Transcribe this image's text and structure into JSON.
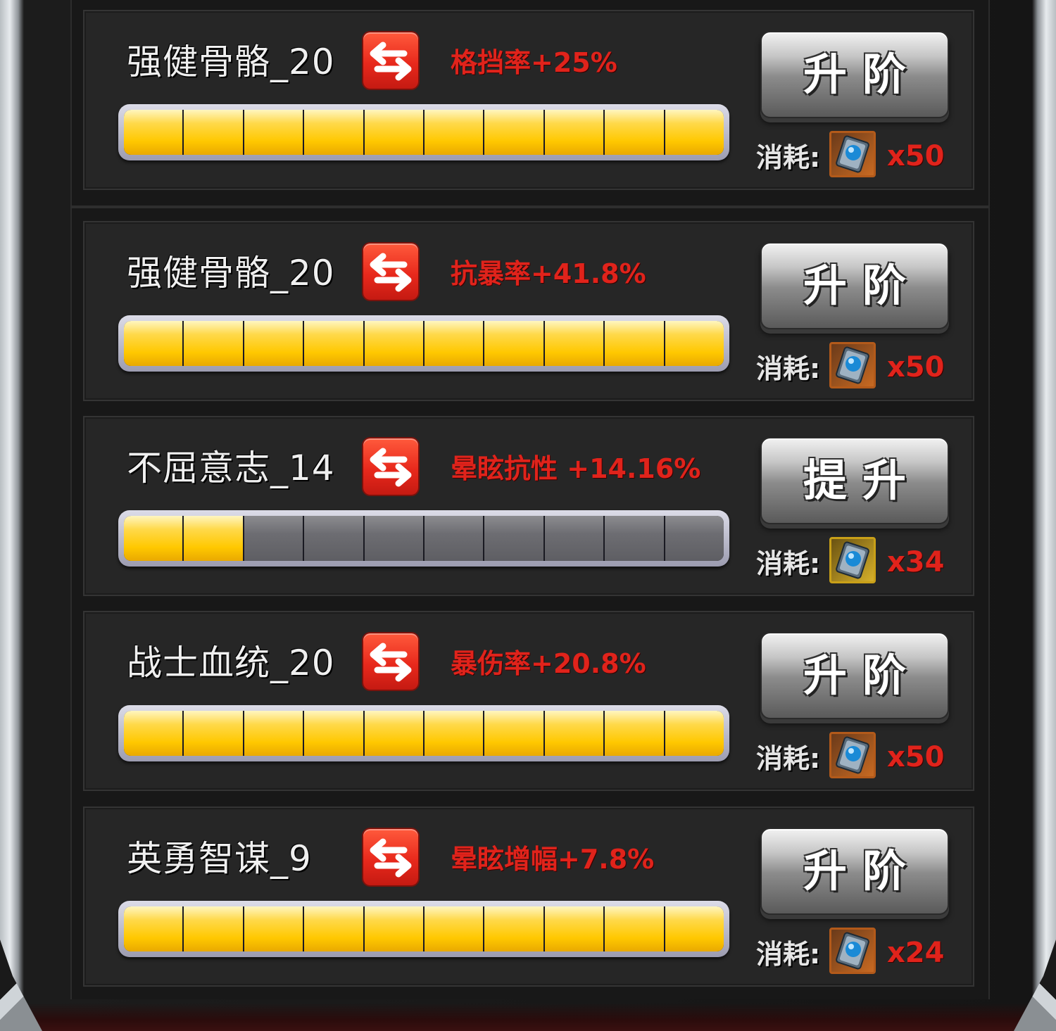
{
  "cost_prefix": "消耗:",
  "skills": [
    {
      "name": "强健骨骼_20",
      "stat": "格挡率+25%",
      "button": "升阶",
      "cost": "x50",
      "filled_segments": 10,
      "total_segments": 10,
      "item_style": "orange",
      "icon": "swap-arrows-icon"
    },
    {
      "name": "强健骨骼_20",
      "stat": "抗暴率+41.8%",
      "button": "升阶",
      "cost": "x50",
      "filled_segments": 10,
      "total_segments": 10,
      "item_style": "orange",
      "icon": "swap-arrows-icon"
    },
    {
      "name": "不屈意志_14",
      "stat": "晕眩抗性 +14.16%",
      "button": "提升",
      "cost": "x34",
      "filled_segments": 2,
      "total_segments": 10,
      "item_style": "gold",
      "icon": "swap-arrows-icon"
    },
    {
      "name": "战士血统_20",
      "stat": "暴伤率+20.8%",
      "button": "升阶",
      "cost": "x50",
      "filled_segments": 10,
      "total_segments": 10,
      "item_style": "orange",
      "icon": "swap-arrows-icon"
    },
    {
      "name": "英勇智谋_9",
      "stat": "晕眩增幅+7.8%",
      "button": "升阶",
      "cost": "x24",
      "filled_segments": 10,
      "total_segments": 10,
      "item_style": "orange",
      "icon": "swap-arrows-icon"
    }
  ],
  "colors": {
    "stat_text": "#e0231b",
    "bar_filled": "#ffc800",
    "bar_empty": "#6d6d72",
    "swap_button": "#e8291c"
  }
}
